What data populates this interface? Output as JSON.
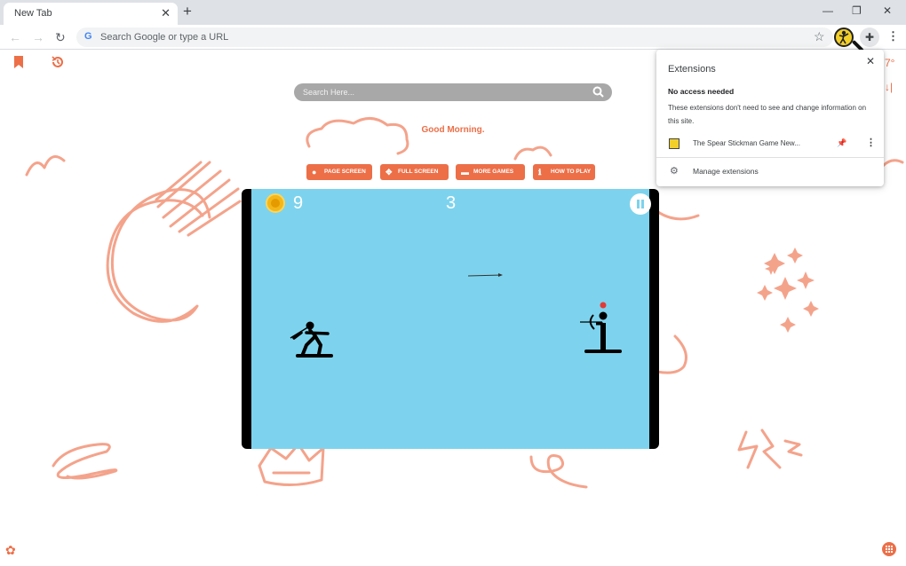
{
  "tab": {
    "title": "New Tab"
  },
  "window": {
    "minimize_icon": "minimize-icon",
    "restore_icon": "restore-icon",
    "close_icon": "close-icon"
  },
  "omnibox": {
    "placeholder": "Search Google or type a URL"
  },
  "page": {
    "search_placeholder": "Search Here...",
    "greeting": "Good Morning.",
    "temp_peek": "7°",
    "buttons": [
      {
        "label": "PAGE SCREEN",
        "icon": "bulb-icon"
      },
      {
        "label": "FULL SCREEN",
        "icon": "arrows-icon"
      },
      {
        "label": "MORE GAMES",
        "icon": "gamepad-icon"
      },
      {
        "label": "HOW TO PLAY",
        "icon": "info-icon"
      }
    ]
  },
  "game": {
    "coins": "9",
    "score": "3"
  },
  "popup": {
    "title": "Extensions",
    "subheading": "No access needed",
    "description": "These extensions don't need to see and change information on this site.",
    "extension_name": "The Spear Stickman Game New...",
    "manage_label": "Manage extensions"
  },
  "colors": {
    "accent": "#ec6f48",
    "game_sky": "#7dd3ed",
    "doodle": "#f4a38b"
  }
}
